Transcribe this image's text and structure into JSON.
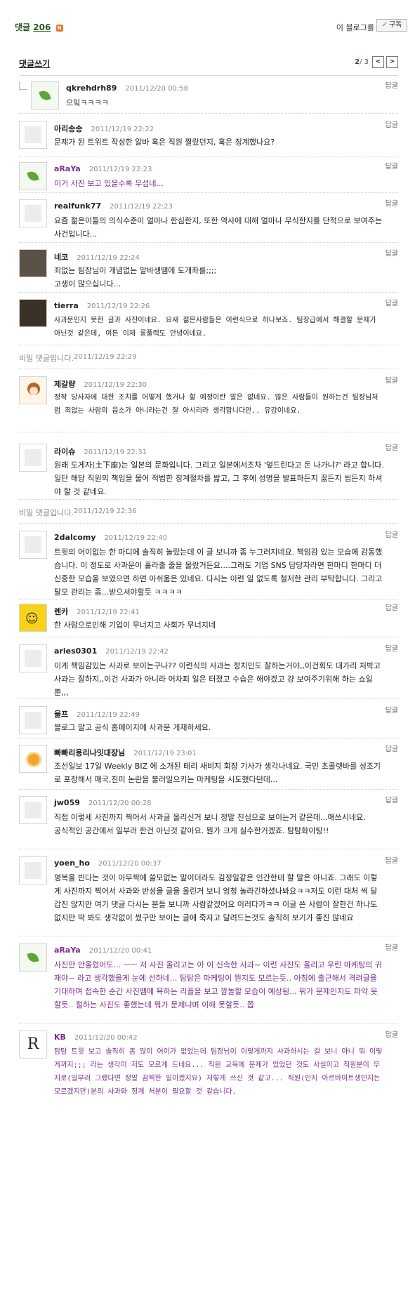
{
  "header": {
    "comments_label": "댓글",
    "comments_count": "206",
    "new_badge": "N",
    "blog_label": "이 블로그를",
    "subscribe_label": "구독"
  },
  "write": {
    "write_link": "댓글쓰기",
    "page_current": "2",
    "page_total": "/ 3",
    "prev": "<",
    "next": ">"
  },
  "reply_label": "답글",
  "comments": [
    {
      "nick": "qkrehdrh89",
      "date": "2011/12/20 00:58",
      "body": "으잌ㅋㅋㅋㅋ"
    },
    {
      "nick": "아리송송",
      "date": "2011/12/19 22:22",
      "body": "문제가 된 트위트 작성한 알바 혹은 직원 짤랐던지, 혹은 징계했나요?"
    },
    {
      "nick": "aRaYa",
      "date": "2011/12/19 22:23",
      "body": "이거 사진 보고 있을수록 무섭네..."
    },
    {
      "nick": "realfunk77",
      "date": "2011/12/19 22:23",
      "body": "요즘 젊은이들의 의식수준이 얼마나 한심한지, 또한 역사에 대해 얼마나 무식한지를 단적으로 보여주는 사건입니다..."
    },
    {
      "nick": "네코",
      "date": "2011/12/19 22:24",
      "body": "죄없는 팀장님이 개념없는 알바생땜에 도개좌를;;;;\n고생이 많으십니다..."
    },
    {
      "nick": "tierra",
      "date": "2011/12/19 22:26",
      "body": "사과문인지 못한 글과 사진이네요. 요새 젊은사람들은 이런식으로 하나보죠. 팀장급에서 해결할 문제가 아닌것 같은데, 여튼 이제 롱풀랙도 안녕이네요."
    },
    {
      "nick": "제갈량",
      "date": "2011/12/19 22:30",
      "body": "정작 당사자에 대한 조치를 어떻게 했거나 할 예정이란 말은 없네요. 많은 사람들이 원하는건 팀장님처럼 죄없는 사람의 읍소가 아니라는건 잘 아시리라 생각합니다만.. 유감이네요."
    },
    {
      "nick": "라이슈",
      "date": "2011/12/19 22:31",
      "body": "원래 도게자(土下座)는 일본의 문화입니다. 그리고 일본에서조차 '엎드린다고 돈 나가냐?' 라고 합니다. 일단 해당 직원의 책임을 물어 적법한 징계절차를 밟고, 그 후에 성명을 발표하든지 꿇든지 씹든지 하셔야 할 것 같네요."
    },
    {
      "nick": "2dalcomy",
      "date": "2011/12/19 22:40",
      "body": "트윗의 어이없는 한 마디에 솔직히 놀랐는데 이 글 보니까 좀 누그러지네요. 책임감 있는 모습에 감동했습니다. 이 정도로 사과문이 훌라출 줄을 몰랐거든요....그래도 기업 SNS 담당자라면 한마디 한마디 더 신중한 모습을 보였으면 하면 아쉬움은 있네요. 다시는 이런 일 없도록 철저한 관리 부탁합니다. 그리고 탈모 관리는 좀...받으셔야할듯 ㅋㅋㅋㅋ"
    },
    {
      "nick": "렌카",
      "date": "2011/12/19 22:41",
      "body": "한 사람으로인해 기업이 무너지고 사회가 무너지네"
    },
    {
      "nick": "aries0301",
      "date": "2011/12/19 22:42",
      "body": "이게 책임감있는 사과로 보이는구나?? 이런식의 사과는 정치인도 잘하는거야,,이건회도 대가리 처박고 사과는 잘하지,,이건 사과가 아니라 어차피 일은 터졌고 수습은 해야겠고 걍 보여주기위해 하는 쇼일뿐,,,"
    },
    {
      "nick": "울프",
      "date": "2011/12/19 22:49",
      "body": "블로그 말고 공식 홈페이지에 사과문 게재하세요."
    },
    {
      "nick": "빠빠리용리나잇대장님",
      "date": "2011/12/19 23:01",
      "body": "조선일보 17일 Weekly BIZ 에 소개된 테리 새비지 회장 기사가 생각나네요. 국민 초콜렛바를 성조기로 포장해서 매국,친미 논란을 불러일으키는 마케팅을 시도했다던데..."
    },
    {
      "nick": "jw059",
      "date": "2011/12/20 00:28",
      "body": "직접 이렇세 사진까지 찍어서 사과글 올리신거 보니 정말 진심으로 보이는거 같은데...애쓰시네요.\n공식적인 공간에서 일부러 한건 아닌것 같아요. 뭔가 크게 실수한거겠죠. 탐탐화이팅!!"
    },
    {
      "nick": "yoen_ho",
      "date": "2011/12/20 00:37",
      "body": "명복을 빈다는 것이 아무짝에 쓸모없는 말이더라도 김정일같은 인간한테 할 말은 아니죠. 그래도 이렇게 사진까지 찍어서 사과와 반성을 글을 올린거 보니 엄청 놀라긴하셨나봐요ㅋㅋ저도 이런 대처 썩 달갑진 않지만 여기 댓글 다시는 분들 보니까 사람같겠어요 이러다가ㅋㅋ 이글 쓴 사람이 잘한건 하나도 없지만 딱 봐도 생각없이 썼구만 보이는 글에 죽자고 달려드는것도 솔직히 보기가 좋진 않네요"
    },
    {
      "nick": "aRaYa",
      "date": "2011/12/20 00:41",
      "body": "사진만 안올렸어도... ㅡㅡ 저 사진 올리고는 아 이 신속한 사과~ 이런 사진도 올리고 우린 마케팅의 귀재야~ 라고 생각했을게 눈에 선하네... 탐탐은 마케팅이 뭔지도 모르는듯.. 아침에 출근해서 격려글을 기대하며 접속한 순간 사진땜에 욕하는 리플을 보고 깜놀할 모습이 예상됨... 뭐가 문제인지도 파악 못할듯.. 절하는 사진도 좋했는데 뭐가 문제냐며 이해 못할듯.. 쯥"
    },
    {
      "nick": "KB",
      "date": "2011/12/20 00:42",
      "body": "탐탐 트윗 보고 솔직히 좀 많이 어이가 없었는데 팀장님이 이렇게까지 사과하시는 걸 보니 아니 뭐 이렇게까지;;; 라는 생각이 저도 모르게 드네요... 직원 교육에 문제가 있었던 것도 사실이고 직원분이 무지로(일부러 그랬다면 정말 끔찍한 일이겠지요) 저렇게 쓰신 것 같고... 직원(인지 아르바이트생인지는 모르겠지만)분의 사과와 징계 처분이 필요할 것 같습니다."
    }
  ],
  "secret": [
    {
      "label": "비밀 댓글입니다.",
      "date": "2011/12/19 22:29"
    },
    {
      "label": "비밀 댓글입니다.",
      "date": "2011/12/19 22:36"
    }
  ]
}
